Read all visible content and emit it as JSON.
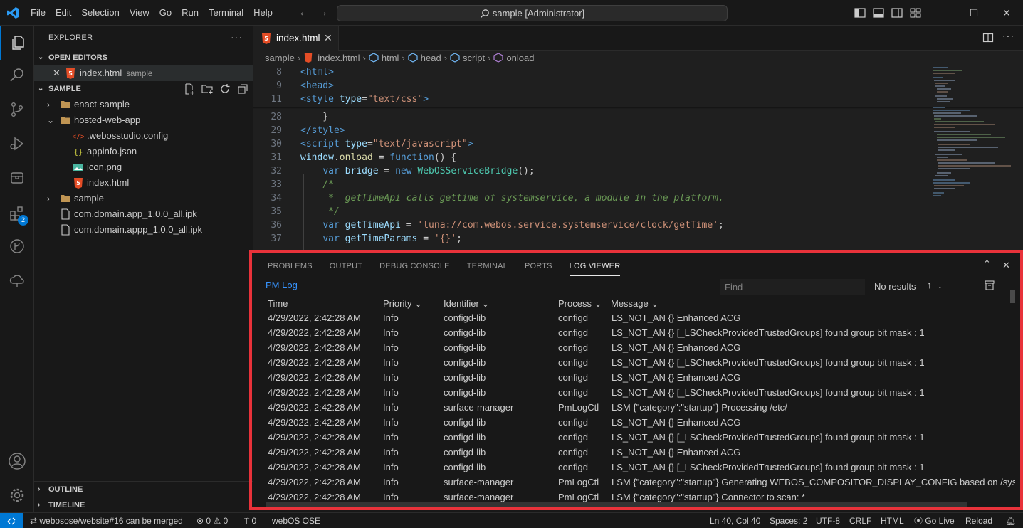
{
  "menubar": [
    "File",
    "Edit",
    "Selection",
    "View",
    "Go",
    "Run",
    "Terminal",
    "Help"
  ],
  "command_center": "sample [Administrator]",
  "window_controls": {
    "minimize": "—",
    "maximize": "☐",
    "close": "✕"
  },
  "activity": {
    "extensions_badge": "2"
  },
  "sidebar": {
    "title": "EXPLORER",
    "more": "···",
    "open_editors": {
      "title": "OPEN EDITORS",
      "items": [
        {
          "name": "index.html",
          "desc": "sample"
        }
      ]
    },
    "folder": {
      "title": "SAMPLE",
      "items": [
        {
          "label": "enact-sample",
          "type": "folder",
          "depth": 0,
          "expanded": false
        },
        {
          "label": "hosted-web-app",
          "type": "folder",
          "depth": 0,
          "expanded": true
        },
        {
          "label": ".webosstudio.config",
          "type": "config",
          "depth": 1
        },
        {
          "label": "appinfo.json",
          "type": "json",
          "depth": 1
        },
        {
          "label": "icon.png",
          "type": "image",
          "depth": 1
        },
        {
          "label": "index.html",
          "type": "html",
          "depth": 1
        },
        {
          "label": "sample",
          "type": "folder",
          "depth": 0,
          "expanded": false
        },
        {
          "label": "com.domain.app_1.0.0_all.ipk",
          "type": "file",
          "depth": 0
        },
        {
          "label": "com.domain.appp_1.0.0_all.ipk",
          "type": "file",
          "depth": 0
        }
      ]
    },
    "outline": "OUTLINE",
    "timeline": "TIMELINE"
  },
  "editor": {
    "tab": {
      "label": "index.html",
      "close": "✕"
    },
    "breadcrumbs": [
      "sample",
      "index.html",
      "html",
      "head",
      "script",
      "onload"
    ],
    "line_numbers": [
      "8",
      "9",
      "11",
      "28",
      "29",
      "30",
      "31",
      "32",
      "33",
      "34",
      "35",
      "36",
      "37"
    ]
  },
  "panel": {
    "tabs": [
      "PROBLEMS",
      "OUTPUT",
      "DEBUG CONSOLE",
      "TERMINAL",
      "PORTS",
      "LOG VIEWER"
    ],
    "active_tab": "LOG VIEWER",
    "pm_log": "PM Log",
    "find_placeholder": "Find",
    "find_status": "No results",
    "columns": [
      "Time",
      "Priority",
      "Identifier",
      "Process",
      "Message"
    ],
    "rows": [
      [
        "4/29/2022, 2:42:28 AM",
        "Info",
        "configd-lib",
        "configd",
        "LS_NOT_AN {} Enhanced ACG"
      ],
      [
        "4/29/2022, 2:42:28 AM",
        "Info",
        "configd-lib",
        "configd",
        "LS_NOT_AN {} [_LSCheckProvidedTrustedGroups] found group bit mask : 1"
      ],
      [
        "4/29/2022, 2:42:28 AM",
        "Info",
        "configd-lib",
        "configd",
        "LS_NOT_AN {} Enhanced ACG"
      ],
      [
        "4/29/2022, 2:42:28 AM",
        "Info",
        "configd-lib",
        "configd",
        "LS_NOT_AN {} [_LSCheckProvidedTrustedGroups] found group bit mask : 1"
      ],
      [
        "4/29/2022, 2:42:28 AM",
        "Info",
        "configd-lib",
        "configd",
        "LS_NOT_AN {} Enhanced ACG"
      ],
      [
        "4/29/2022, 2:42:28 AM",
        "Info",
        "configd-lib",
        "configd",
        "LS_NOT_AN {} [_LSCheckProvidedTrustedGroups] found group bit mask : 1"
      ],
      [
        "4/29/2022, 2:42:28 AM",
        "Info",
        "surface-manager",
        "PmLogCtl",
        "LSM {\"category\":\"startup\"} Processing /etc/"
      ],
      [
        "4/29/2022, 2:42:28 AM",
        "Info",
        "configd-lib",
        "configd",
        "LS_NOT_AN {} Enhanced ACG"
      ],
      [
        "4/29/2022, 2:42:28 AM",
        "Info",
        "configd-lib",
        "configd",
        "LS_NOT_AN {} [_LSCheckProvidedTrustedGroups] found group bit mask : 1"
      ],
      [
        "4/29/2022, 2:42:28 AM",
        "Info",
        "configd-lib",
        "configd",
        "LS_NOT_AN {} Enhanced ACG"
      ],
      [
        "4/29/2022, 2:42:28 AM",
        "Info",
        "configd-lib",
        "configd",
        "LS_NOT_AN {} [_LSCheckProvidedTrustedGroups] found group bit mask : 1"
      ],
      [
        "4/29/2022, 2:42:28 AM",
        "Info",
        "surface-manager",
        "PmLogCtl",
        "LSM {\"category\":\"startup\"} Generating WEBOS_COMPOSITOR_DISPLAY_CONFIG based on /sys/clas"
      ],
      [
        "4/29/2022, 2:42:28 AM",
        "Info",
        "surface-manager",
        "PmLogCtl",
        "LSM {\"category\":\"startup\"} Connector to scan: *"
      ]
    ]
  },
  "statusbar": {
    "branch": "webosose/website#16 can be merged",
    "errors": "0",
    "warnings": "0",
    "ports": "0",
    "target": "webOS OSE",
    "position": "Ln 40, Col 40",
    "spaces": "Spaces: 2",
    "encoding": "UTF-8",
    "eol": "CRLF",
    "language": "HTML",
    "golive": "Go Live",
    "reload": "Reload"
  },
  "colors": {
    "accent": "#0078d4",
    "highlight": "#e8323a",
    "link": "#3794ff"
  }
}
